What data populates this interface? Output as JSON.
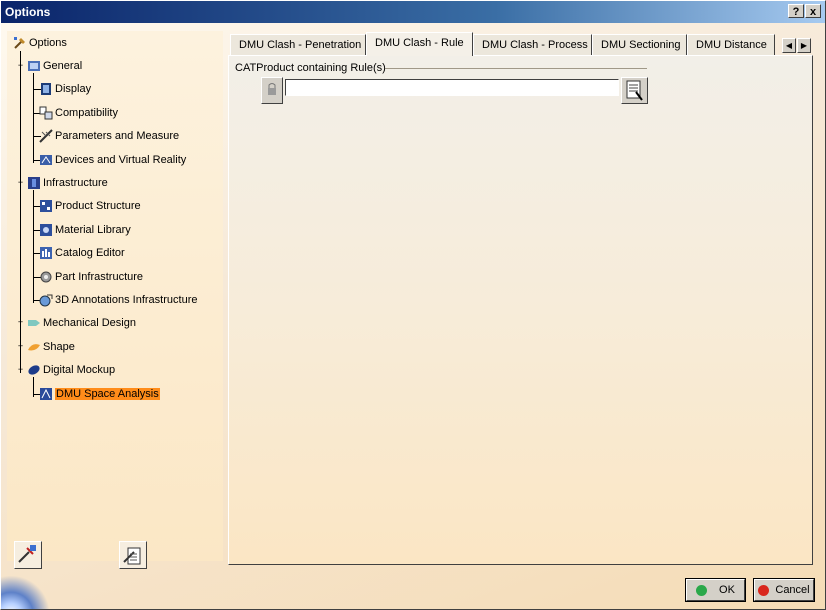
{
  "window": {
    "title": "Options",
    "help_label": "?",
    "close_label": "x"
  },
  "tree": {
    "root": "Options",
    "items": [
      {
        "label": "General",
        "icon": "general-icon"
      },
      {
        "label": "Display",
        "icon": "display-icon"
      },
      {
        "label": "Compatibility",
        "icon": "compatibility-icon"
      },
      {
        "label": "Parameters and Measure",
        "icon": "parameters-icon"
      },
      {
        "label": "Devices and Virtual Reality",
        "icon": "devices-icon"
      },
      {
        "label": "Infrastructure",
        "icon": "infrastructure-icon"
      },
      {
        "label": "Product Structure",
        "icon": "product-structure-icon"
      },
      {
        "label": "Material Library",
        "icon": "material-library-icon"
      },
      {
        "label": "Catalog Editor",
        "icon": "catalog-editor-icon"
      },
      {
        "label": "Part Infrastructure",
        "icon": "part-infrastructure-icon"
      },
      {
        "label": "3D Annotations Infrastructure",
        "icon": "annotations-icon"
      },
      {
        "label": "Mechanical Design",
        "icon": "mechanical-design-icon"
      },
      {
        "label": "Shape",
        "icon": "shape-icon"
      },
      {
        "label": "Digital Mockup",
        "icon": "digital-mockup-icon"
      },
      {
        "label": "DMU Space Analysis",
        "icon": "dmu-space-analysis-icon",
        "selected": true
      }
    ]
  },
  "tabs": [
    {
      "label": "DMU Clash - Penetration"
    },
    {
      "label": "DMU Clash - Rule",
      "active": true
    },
    {
      "label": "DMU Clash - Process"
    },
    {
      "label": "DMU Sectioning"
    },
    {
      "label": "DMU Distance"
    }
  ],
  "tab_scroll": {
    "left": "◀",
    "right": "▶"
  },
  "rule_panel": {
    "group_label": "CATProduct containing Rule(s)",
    "input_value": ""
  },
  "buttons": {
    "ok": "OK",
    "cancel": "Cancel"
  },
  "colors": {
    "selected": "#ff8c1a",
    "ok_dot": "#2aa84a",
    "cancel_dot": "#d9261c",
    "titlebar": "#0a246a"
  }
}
